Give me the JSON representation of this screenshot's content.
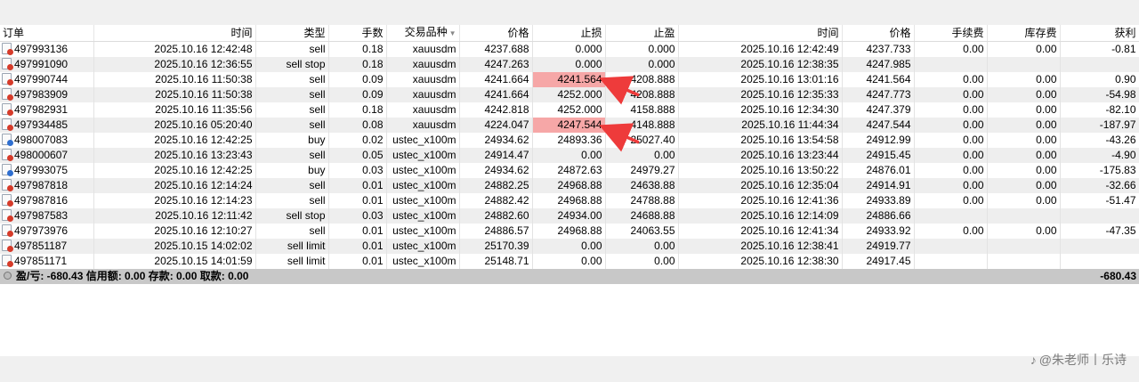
{
  "columns": [
    "订单",
    "时间",
    "类型",
    "手数",
    "交易品种",
    "价格",
    "止损",
    "止盈",
    "时间",
    "价格",
    "手续费",
    "库存费",
    "获利"
  ],
  "rows": [
    {
      "order": "497993136",
      "open_time": "2025.10.16 12:42:48",
      "type": "sell",
      "lots": "0.18",
      "symbol": "xauusdm",
      "price": "4237.688",
      "sl": "0.000",
      "tp": "0.000",
      "close_time": "2025.10.16 12:42:49",
      "close_price": "4237.733",
      "commission": "0.00",
      "swap": "0.00",
      "profit": "-0.81",
      "dir": "sell"
    },
    {
      "order": "497991090",
      "open_time": "2025.10.16 12:36:55",
      "type": "sell stop",
      "lots": "0.18",
      "symbol": "xauusdm",
      "price": "4247.263",
      "sl": "0.000",
      "tp": "0.000",
      "close_time": "2025.10.16 12:38:35",
      "close_price": "4247.985",
      "commission": "",
      "swap": "",
      "profit": "",
      "dir": "sell"
    },
    {
      "order": "497990744",
      "open_time": "2025.10.16 11:50:38",
      "type": "sell",
      "lots": "0.09",
      "symbol": "xauusdm",
      "price": "4241.664",
      "sl": "4241.564",
      "tp": "4208.888",
      "close_time": "2025.10.16 13:01:16",
      "close_price": "4241.564",
      "commission": "0.00",
      "swap": "0.00",
      "profit": "0.90",
      "dir": "sell",
      "highlight_sl": true
    },
    {
      "order": "497983909",
      "open_time": "2025.10.16 11:50:38",
      "type": "sell",
      "lots": "0.09",
      "symbol": "xauusdm",
      "price": "4241.664",
      "sl": "4252.000",
      "tp": "4208.888",
      "close_time": "2025.10.16 12:35:33",
      "close_price": "4247.773",
      "commission": "0.00",
      "swap": "0.00",
      "profit": "-54.98",
      "dir": "sell"
    },
    {
      "order": "497982931",
      "open_time": "2025.10.16 11:35:56",
      "type": "sell",
      "lots": "0.18",
      "symbol": "xauusdm",
      "price": "4242.818",
      "sl": "4252.000",
      "tp": "4158.888",
      "close_time": "2025.10.16 12:34:30",
      "close_price": "4247.379",
      "commission": "0.00",
      "swap": "0.00",
      "profit": "-82.10",
      "dir": "sell"
    },
    {
      "order": "497934485",
      "open_time": "2025.10.16 05:20:40",
      "type": "sell",
      "lots": "0.08",
      "symbol": "xauusdm",
      "price": "4224.047",
      "sl": "4247.544",
      "tp": "4148.888",
      "close_time": "2025.10.16 11:44:34",
      "close_price": "4247.544",
      "commission": "0.00",
      "swap": "0.00",
      "profit": "-187.97",
      "dir": "sell",
      "highlight_sl": true
    },
    {
      "order": "498007083",
      "open_time": "2025.10.16 12:42:25",
      "type": "buy",
      "lots": "0.02",
      "symbol": "ustec_x100m",
      "price": "24934.62",
      "sl": "24893.36",
      "tp": "25027.40",
      "close_time": "2025.10.16 13:54:58",
      "close_price": "24912.99",
      "commission": "0.00",
      "swap": "0.00",
      "profit": "-43.26",
      "dir": "buy"
    },
    {
      "order": "498000607",
      "open_time": "2025.10.16 13:23:43",
      "type": "sell",
      "lots": "0.05",
      "symbol": "ustec_x100m",
      "price": "24914.47",
      "sl": "0.00",
      "tp": "0.00",
      "close_time": "2025.10.16 13:23:44",
      "close_price": "24915.45",
      "commission": "0.00",
      "swap": "0.00",
      "profit": "-4.90",
      "dir": "sell"
    },
    {
      "order": "497993075",
      "open_time": "2025.10.16 12:42:25",
      "type": "buy",
      "lots": "0.03",
      "symbol": "ustec_x100m",
      "price": "24934.62",
      "sl": "24872.63",
      "tp": "24979.27",
      "close_time": "2025.10.16 13:50:22",
      "close_price": "24876.01",
      "commission": "0.00",
      "swap": "0.00",
      "profit": "-175.83",
      "dir": "buy"
    },
    {
      "order": "497987818",
      "open_time": "2025.10.16 12:14:24",
      "type": "sell",
      "lots": "0.01",
      "symbol": "ustec_x100m",
      "price": "24882.25",
      "sl": "24968.88",
      "tp": "24638.88",
      "close_time": "2025.10.16 12:35:04",
      "close_price": "24914.91",
      "commission": "0.00",
      "swap": "0.00",
      "profit": "-32.66",
      "dir": "sell"
    },
    {
      "order": "497987816",
      "open_time": "2025.10.16 12:14:23",
      "type": "sell",
      "lots": "0.01",
      "symbol": "ustec_x100m",
      "price": "24882.42",
      "sl": "24968.88",
      "tp": "24788.88",
      "close_time": "2025.10.16 12:41:36",
      "close_price": "24933.89",
      "commission": "0.00",
      "swap": "0.00",
      "profit": "-51.47",
      "dir": "sell"
    },
    {
      "order": "497987583",
      "open_time": "2025.10.16 12:11:42",
      "type": "sell stop",
      "lots": "0.03",
      "symbol": "ustec_x100m",
      "price": "24882.60",
      "sl": "24934.00",
      "tp": "24688.88",
      "close_time": "2025.10.16 12:14:09",
      "close_price": "24886.66",
      "commission": "",
      "swap": "",
      "profit": "",
      "dir": "sell"
    },
    {
      "order": "497973976",
      "open_time": "2025.10.16 12:10:27",
      "type": "sell",
      "lots": "0.01",
      "symbol": "ustec_x100m",
      "price": "24886.57",
      "sl": "24968.88",
      "tp": "24063.55",
      "close_time": "2025.10.16 12:41:34",
      "close_price": "24933.92",
      "commission": "0.00",
      "swap": "0.00",
      "profit": "-47.35",
      "dir": "sell"
    },
    {
      "order": "497851187",
      "open_time": "2025.10.15 14:02:02",
      "type": "sell limit",
      "lots": "0.01",
      "symbol": "ustec_x100m",
      "price": "25170.39",
      "sl": "0.00",
      "tp": "0.00",
      "close_time": "2025.10.16 12:38:41",
      "close_price": "24919.77",
      "commission": "",
      "swap": "",
      "profit": "",
      "dir": "sell"
    },
    {
      "order": "497851171",
      "open_time": "2025.10.15 14:01:59",
      "type": "sell limit",
      "lots": "0.01",
      "symbol": "ustec_x100m",
      "price": "25148.71",
      "sl": "0.00",
      "tp": "0.00",
      "close_time": "2025.10.16 12:38:30",
      "close_price": "24917.45",
      "commission": "",
      "swap": "",
      "profit": "",
      "dir": "sell"
    }
  ],
  "summary": {
    "text": "盈/亏: -680.43  信用额: 0.00  存款: 0.00  取款: 0.00",
    "total": "-680.43"
  },
  "watermark": {
    "text": "@朱老师丨乐诗"
  },
  "colors": {
    "highlight": "#f6a7a7",
    "arrow": "#ee3b3b",
    "summary_bg": "#c8c8c8"
  }
}
